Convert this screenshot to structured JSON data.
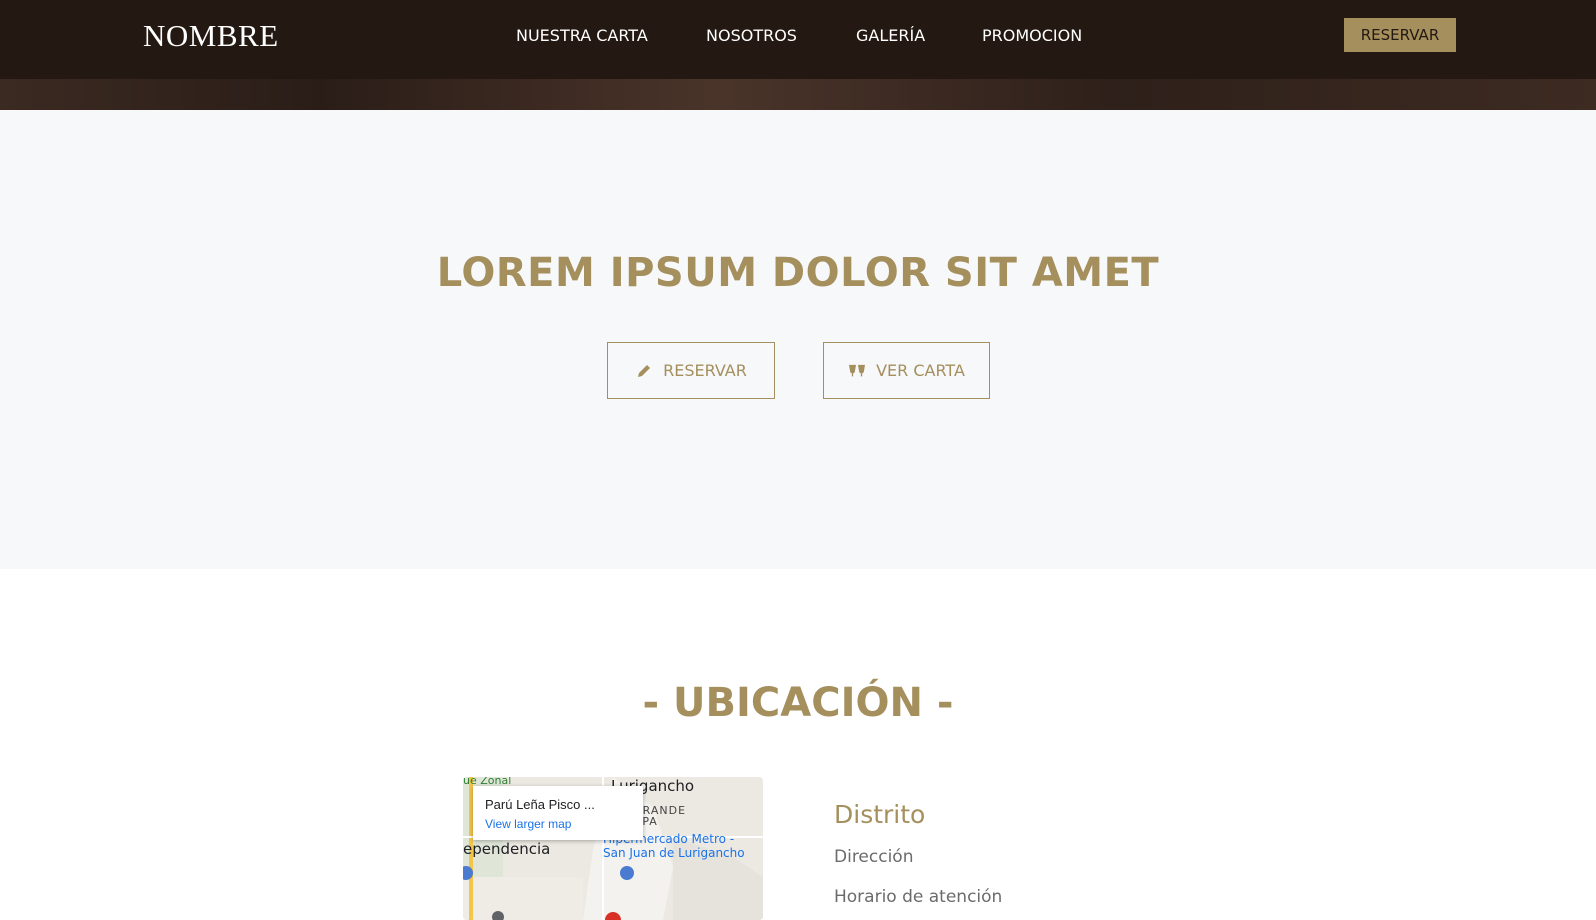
{
  "header": {
    "brand": "NOMBRE",
    "nav": [
      "NUESTRA CARTA",
      "NOSOTROS",
      "GALERÍA",
      "PROMOCION"
    ],
    "reserve_button": "RESERVAR"
  },
  "banner": {
    "title": "LOREM IPSUM DOLOR SIT AMET",
    "reserve_button": "RESERVAR",
    "menu_button": "VER CARTA",
    "reserve_icon": "pencil-icon",
    "menu_icon": "toast-glasses-icon"
  },
  "location": {
    "title": "- UBICACIÓN -",
    "map": {
      "place_name": "Parú Leña Pisco ...",
      "larger_map_link": "View larger map",
      "labels": [
        "Lurigancho",
        "O GRANDE",
        "ETAPA",
        "Hipermercado Metro -",
        "San Juan de Lurigancho",
        "ependencia",
        "ue Zonal"
      ]
    },
    "district": "Distrito",
    "address": "Dirección",
    "hours": "Horario de atención"
  },
  "colors": {
    "accent": "#a48f5d",
    "navbar": "#231812",
    "banner_bg": "#f7f8fa"
  }
}
